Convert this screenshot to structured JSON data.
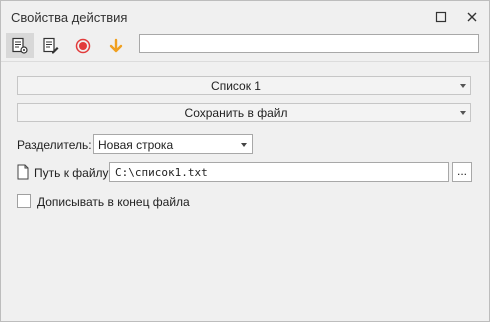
{
  "window": {
    "title": "Свойства действия",
    "maximize_icon": "maximize-icon",
    "close_icon": "close-icon"
  },
  "toolbar": {
    "tools": [
      {
        "icon": "settings-document-icon",
        "active": true
      },
      {
        "icon": "edit-document-icon",
        "active": false
      },
      {
        "icon": "record-icon",
        "color": "#e23b3b",
        "active": false
      },
      {
        "icon": "arrow-down-icon",
        "color": "#f0a020",
        "active": false
      }
    ],
    "search_value": ""
  },
  "list_combo": {
    "label": "Список 1"
  },
  "action_combo": {
    "label": "Сохранить в файл"
  },
  "separator": {
    "label": "Разделитель:",
    "value": "Новая строка"
  },
  "file_path": {
    "label": "Путь к файлу",
    "value": "C:\\список1.txt",
    "browse_label": "..."
  },
  "append": {
    "label": "Дописывать в конец файла",
    "checked": false
  }
}
